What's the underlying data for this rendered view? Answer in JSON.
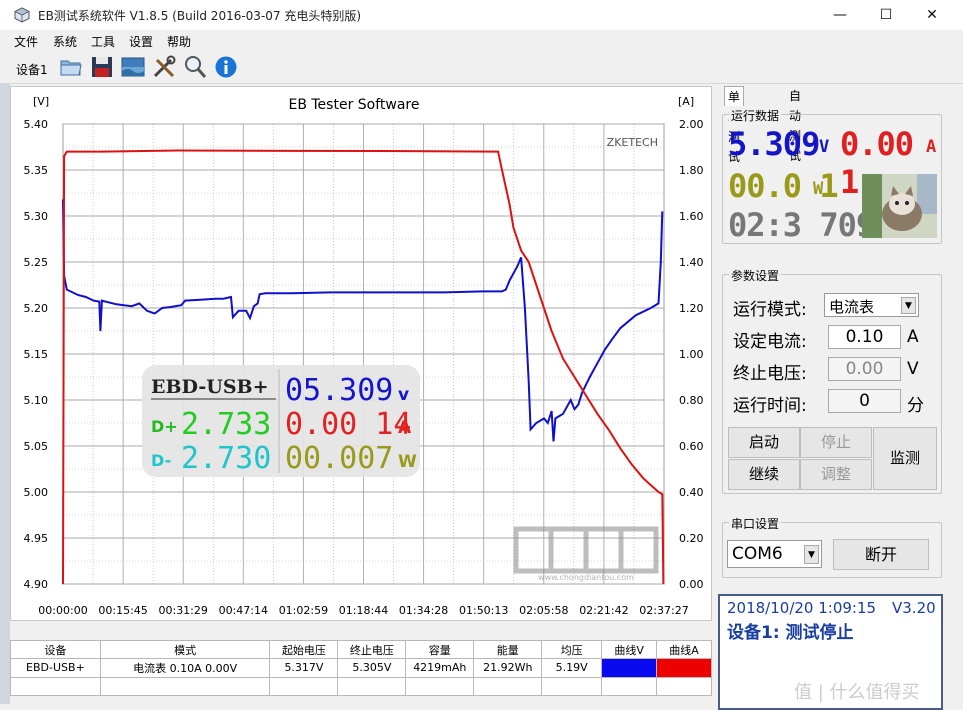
{
  "window": {
    "title": "EB测试系统软件 V1.8.5 (Build 2016-03-07 充电头特别版)",
    "minimize_glyph": "—",
    "maximize_glyph": "☐",
    "close_glyph": "✕"
  },
  "menu": [
    "文件",
    "系统",
    "工具",
    "设置",
    "帮助"
  ],
  "toolbar": {
    "device_label": "设备1",
    "icons": [
      "open-folder-icon",
      "save-icon",
      "screenshot-icon",
      "tools-icon",
      "search-icon",
      "info-icon"
    ]
  },
  "chart": {
    "title": "EB Tester Software",
    "left_unit": "[V]",
    "right_unit": "[A]",
    "watermark": "ZKETECH",
    "colors": {
      "voltage": "#1010cc",
      "current": "#dd1111",
      "grid": "#9a9a9a"
    }
  },
  "overlay": {
    "model": "EBD-USB+",
    "voltage": "05.309",
    "voltage_unit": "v",
    "current": "0.00 14",
    "current_unit": "A",
    "power": "00.007",
    "power_unit": "W",
    "dplus_label": "D+",
    "dplus": "2.733",
    "dminus_label": "D-",
    "dminus": "2.730"
  },
  "logo": {
    "sub": "www.chongdiantou.com"
  },
  "chart_data": {
    "type": "line",
    "title": "EB Tester Software",
    "xlabel": "",
    "ylabel": "[V]",
    "y2label": "[A]",
    "x_ticks": [
      "00:00:00",
      "00:15:45",
      "00:31:29",
      "00:47:14",
      "01:02:59",
      "01:18:44",
      "01:34:28",
      "01:50:13",
      "02:05:58",
      "02:21:42",
      "02:37:27"
    ],
    "y_ticks": [
      "5.40",
      "5.35",
      "5.30",
      "5.25",
      "5.20",
      "5.15",
      "5.10",
      "5.05",
      "5.00",
      "4.95",
      "4.90"
    ],
    "y2_ticks": [
      "2.00",
      "1.80",
      "1.60",
      "1.40",
      "1.20",
      "1.00",
      "0.80",
      "0.60",
      "0.40",
      "0.20",
      "0.00"
    ],
    "ylim": [
      4.9,
      5.4
    ],
    "y2lim": [
      0,
      2.0
    ],
    "xlim_min": [
      0,
      157.45
    ],
    "grid": true,
    "series": [
      {
        "name": "曲线V",
        "axis": "left",
        "color": "#1010cc",
        "points_min": [
          [
            0,
            5.318
          ],
          [
            0.3,
            5.235
          ],
          [
            1,
            5.22
          ],
          [
            4,
            5.214
          ],
          [
            6,
            5.212
          ],
          [
            8,
            5.208
          ],
          [
            9.5,
            5.207
          ],
          [
            9.8,
            5.175
          ],
          [
            10.2,
            5.208
          ],
          [
            14,
            5.204
          ],
          [
            18,
            5.202
          ],
          [
            20,
            5.205
          ],
          [
            22,
            5.197
          ],
          [
            24,
            5.194
          ],
          [
            26,
            5.2
          ],
          [
            28,
            5.201
          ],
          [
            31,
            5.203
          ],
          [
            32,
            5.208
          ],
          [
            36,
            5.209
          ],
          [
            40,
            5.21
          ],
          [
            42,
            5.21
          ],
          [
            43,
            5.211
          ],
          [
            44,
            5.212
          ],
          [
            44.5,
            5.19
          ],
          [
            46,
            5.197
          ],
          [
            48,
            5.197
          ],
          [
            49,
            5.189
          ],
          [
            50,
            5.202
          ],
          [
            51,
            5.205
          ],
          [
            51.5,
            5.215
          ],
          [
            53,
            5.216
          ],
          [
            60,
            5.216
          ],
          [
            70,
            5.217
          ],
          [
            80,
            5.217
          ],
          [
            90,
            5.217
          ],
          [
            100,
            5.217
          ],
          [
            110,
            5.218
          ],
          [
            115,
            5.218
          ],
          [
            116,
            5.22
          ],
          [
            117,
            5.23
          ],
          [
            119,
            5.245
          ],
          [
            120,
            5.255
          ],
          [
            121,
            5.2
          ],
          [
            122,
            5.12
          ],
          [
            122.5,
            5.068
          ],
          [
            124,
            5.075
          ],
          [
            126,
            5.08
          ],
          [
            127,
            5.075
          ],
          [
            128,
            5.088
          ],
          [
            128.5,
            5.055
          ],
          [
            129,
            5.08
          ],
          [
            131,
            5.085
          ],
          [
            133,
            5.1
          ],
          [
            134,
            5.09
          ],
          [
            135,
            5.095
          ],
          [
            136,
            5.108
          ],
          [
            138,
            5.125
          ],
          [
            140,
            5.14
          ],
          [
            142,
            5.155
          ],
          [
            144,
            5.167
          ],
          [
            146,
            5.178
          ],
          [
            148,
            5.185
          ],
          [
            150,
            5.192
          ],
          [
            152,
            5.196
          ],
          [
            154,
            5.2
          ],
          [
            156,
            5.205
          ],
          [
            156.6,
            5.25
          ],
          [
            157,
            5.305
          ]
        ]
      },
      {
        "name": "曲线A",
        "axis": "right",
        "color": "#dd1111",
        "points_min": [
          [
            0,
            0.0
          ],
          [
            0.3,
            1.86
          ],
          [
            1,
            1.88
          ],
          [
            10,
            1.88
          ],
          [
            30,
            1.885
          ],
          [
            60,
            1.883
          ],
          [
            90,
            1.882
          ],
          [
            114,
            1.88
          ],
          [
            115,
            1.8
          ],
          [
            117,
            1.65
          ],
          [
            118,
            1.55
          ],
          [
            120,
            1.45
          ],
          [
            122,
            1.4
          ],
          [
            125,
            1.25
          ],
          [
            128,
            1.1
          ],
          [
            131,
            0.98
          ],
          [
            134,
            0.9
          ],
          [
            137,
            0.82
          ],
          [
            140,
            0.74
          ],
          [
            143,
            0.67
          ],
          [
            146,
            0.59
          ],
          [
            149,
            0.52
          ],
          [
            152,
            0.46
          ],
          [
            154,
            0.43
          ],
          [
            156,
            0.4
          ],
          [
            157,
            0.39
          ],
          [
            157.3,
            0.0
          ]
        ]
      }
    ]
  },
  "table": {
    "headers": [
      "设备",
      "模式",
      "起始电压",
      "终止电压",
      "容量",
      "能量",
      "均压",
      "曲线V",
      "曲线A"
    ],
    "row": [
      "EBD-USB+",
      "电流表  0.10A  0.00V",
      "5.317V",
      "5.305V",
      "4219mAh",
      "21.92Wh",
      "5.19V"
    ],
    "swatch_v": "#0a0af0",
    "swatch_a": "#ee0000"
  },
  "right": {
    "tabs": [
      "单次测试",
      "自动测试"
    ],
    "run_data": {
      "legend": "运行数据",
      "voltage": "5.309",
      "voltage_unit": "V",
      "current": "0.00 1",
      "current_unit": "A",
      "power": "00.0 1",
      "power_unit": "W",
      "time": "02:3 709"
    },
    "params": {
      "legend": "参数设置",
      "mode_label": "运行模式:",
      "mode_value": "电流表",
      "current_label": "设定电流:",
      "current_value": "0.10",
      "current_unit": "A",
      "voltage_label": "终止电压:",
      "voltage_value": "0.00",
      "voltage_unit": "V",
      "time_label": "运行时间:",
      "time_value": "0",
      "time_unit": "分"
    },
    "buttons": {
      "start": "启动",
      "stop": "停止",
      "continue": "继续",
      "adjust": "调整",
      "monitor": "监测"
    },
    "serial": {
      "legend": "串口设置",
      "port": "COM6",
      "disconnect": "断开"
    },
    "status": {
      "datetime": "2018/10/20 1:09:15",
      "version": "V3.20",
      "message": "设备1: 测试停止"
    },
    "watermark": "值 | 什么值得买"
  }
}
